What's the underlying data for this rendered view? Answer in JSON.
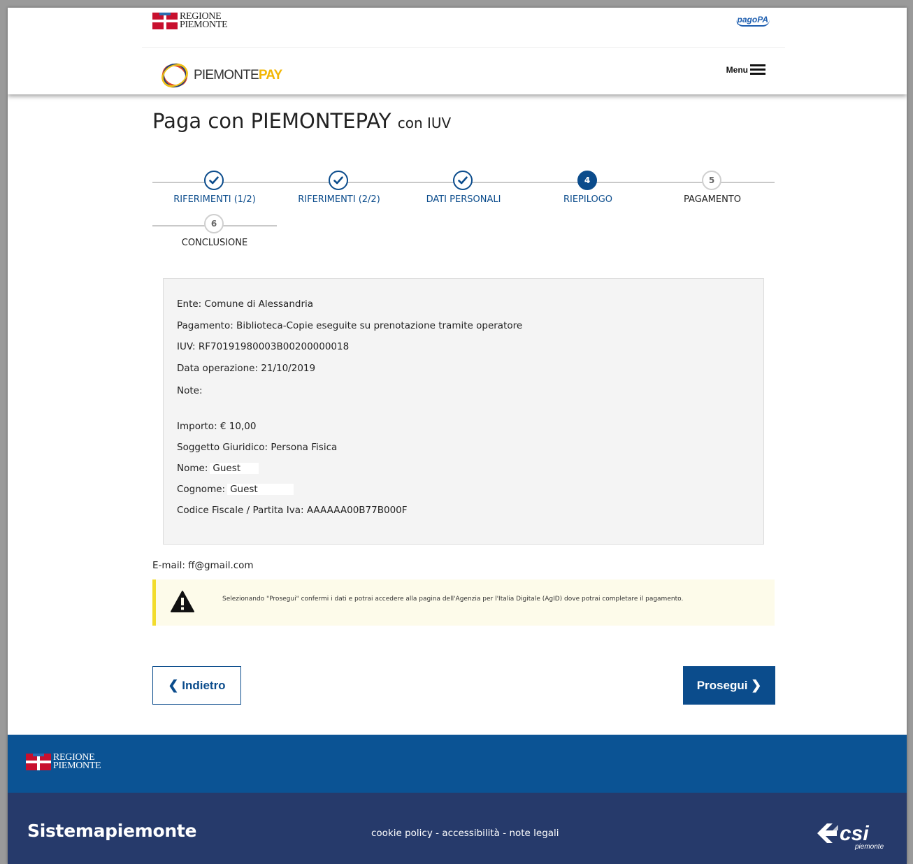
{
  "header": {
    "region_logo_line1": "REGIONE",
    "region_logo_line2": "PIEMONTE",
    "pagopa_label": "pagoPA",
    "brand_piemonte": "PIEMONTE",
    "brand_pay": "PAY",
    "menu_label": "Menu"
  },
  "page": {
    "title": "Paga con PIEMONTEPAY",
    "title_suffix": "con IUV"
  },
  "steps": [
    {
      "label": "RIFERIMENTI (1/2)",
      "status": "done"
    },
    {
      "label": "RIFERIMENTI (2/2)",
      "status": "done"
    },
    {
      "label": "DATI PERSONALI",
      "status": "done"
    },
    {
      "label": "RIEPILOGO",
      "status": "active",
      "number": "4"
    },
    {
      "label": "PAGAMENTO",
      "status": "todo",
      "number": "5"
    },
    {
      "label": "CONCLUSIONE",
      "status": "todo",
      "number": "6"
    }
  ],
  "summary": {
    "ente": "Ente: Comune di Alessandria",
    "pagamento": "Pagamento: Biblioteca-Copie eseguite su prenotazione tramite operatore",
    "iuv": "IUV: RF70191980003B00200000018",
    "data_operazione": "Data operazione: 21/10/2019",
    "note": "Note:",
    "importo": "Importo:  € 10,00",
    "soggetto": "Soggetto Giuridico: Persona Fisica",
    "nome_label": "Nome:",
    "nome_value": "Guest",
    "cognome_label": "Cognome:",
    "cognome_value": "Guest",
    "codice_fiscale": "Codice Fiscale / Partita Iva: AAAAAA00B77B000F"
  },
  "email": "E-mail: ff@gmail.com",
  "warning": {
    "message": "Selezionando \"Prosegui\" confermi i dati e potrai accedere alla pagina dell'Agenzia per l'Italia Digitale (AgID) dove potrai completare il pagamento."
  },
  "buttons": {
    "back_label": "Indietro",
    "next_label": "Prosegui"
  },
  "footer": {
    "region_logo_line1": "REGIONE",
    "region_logo_line2": "PIEMONTE",
    "brand": "Sistemapiemonte",
    "link_cookie": "cookie policy",
    "link_accessibility": "accessibilità",
    "link_legal": "note legali",
    "separator": " - ",
    "csi_logo_text": "csi",
    "csi_logo_sub": "piemonte"
  },
  "colors": {
    "primary": "#0b4c8c",
    "footer_blue": "#0b5394",
    "footer_navy": "#263a6b",
    "warning_bg": "#fdfbea",
    "warning_border": "#f2dc2c",
    "region_red": "#c8102e",
    "pay_yellow": "#f2b705"
  }
}
